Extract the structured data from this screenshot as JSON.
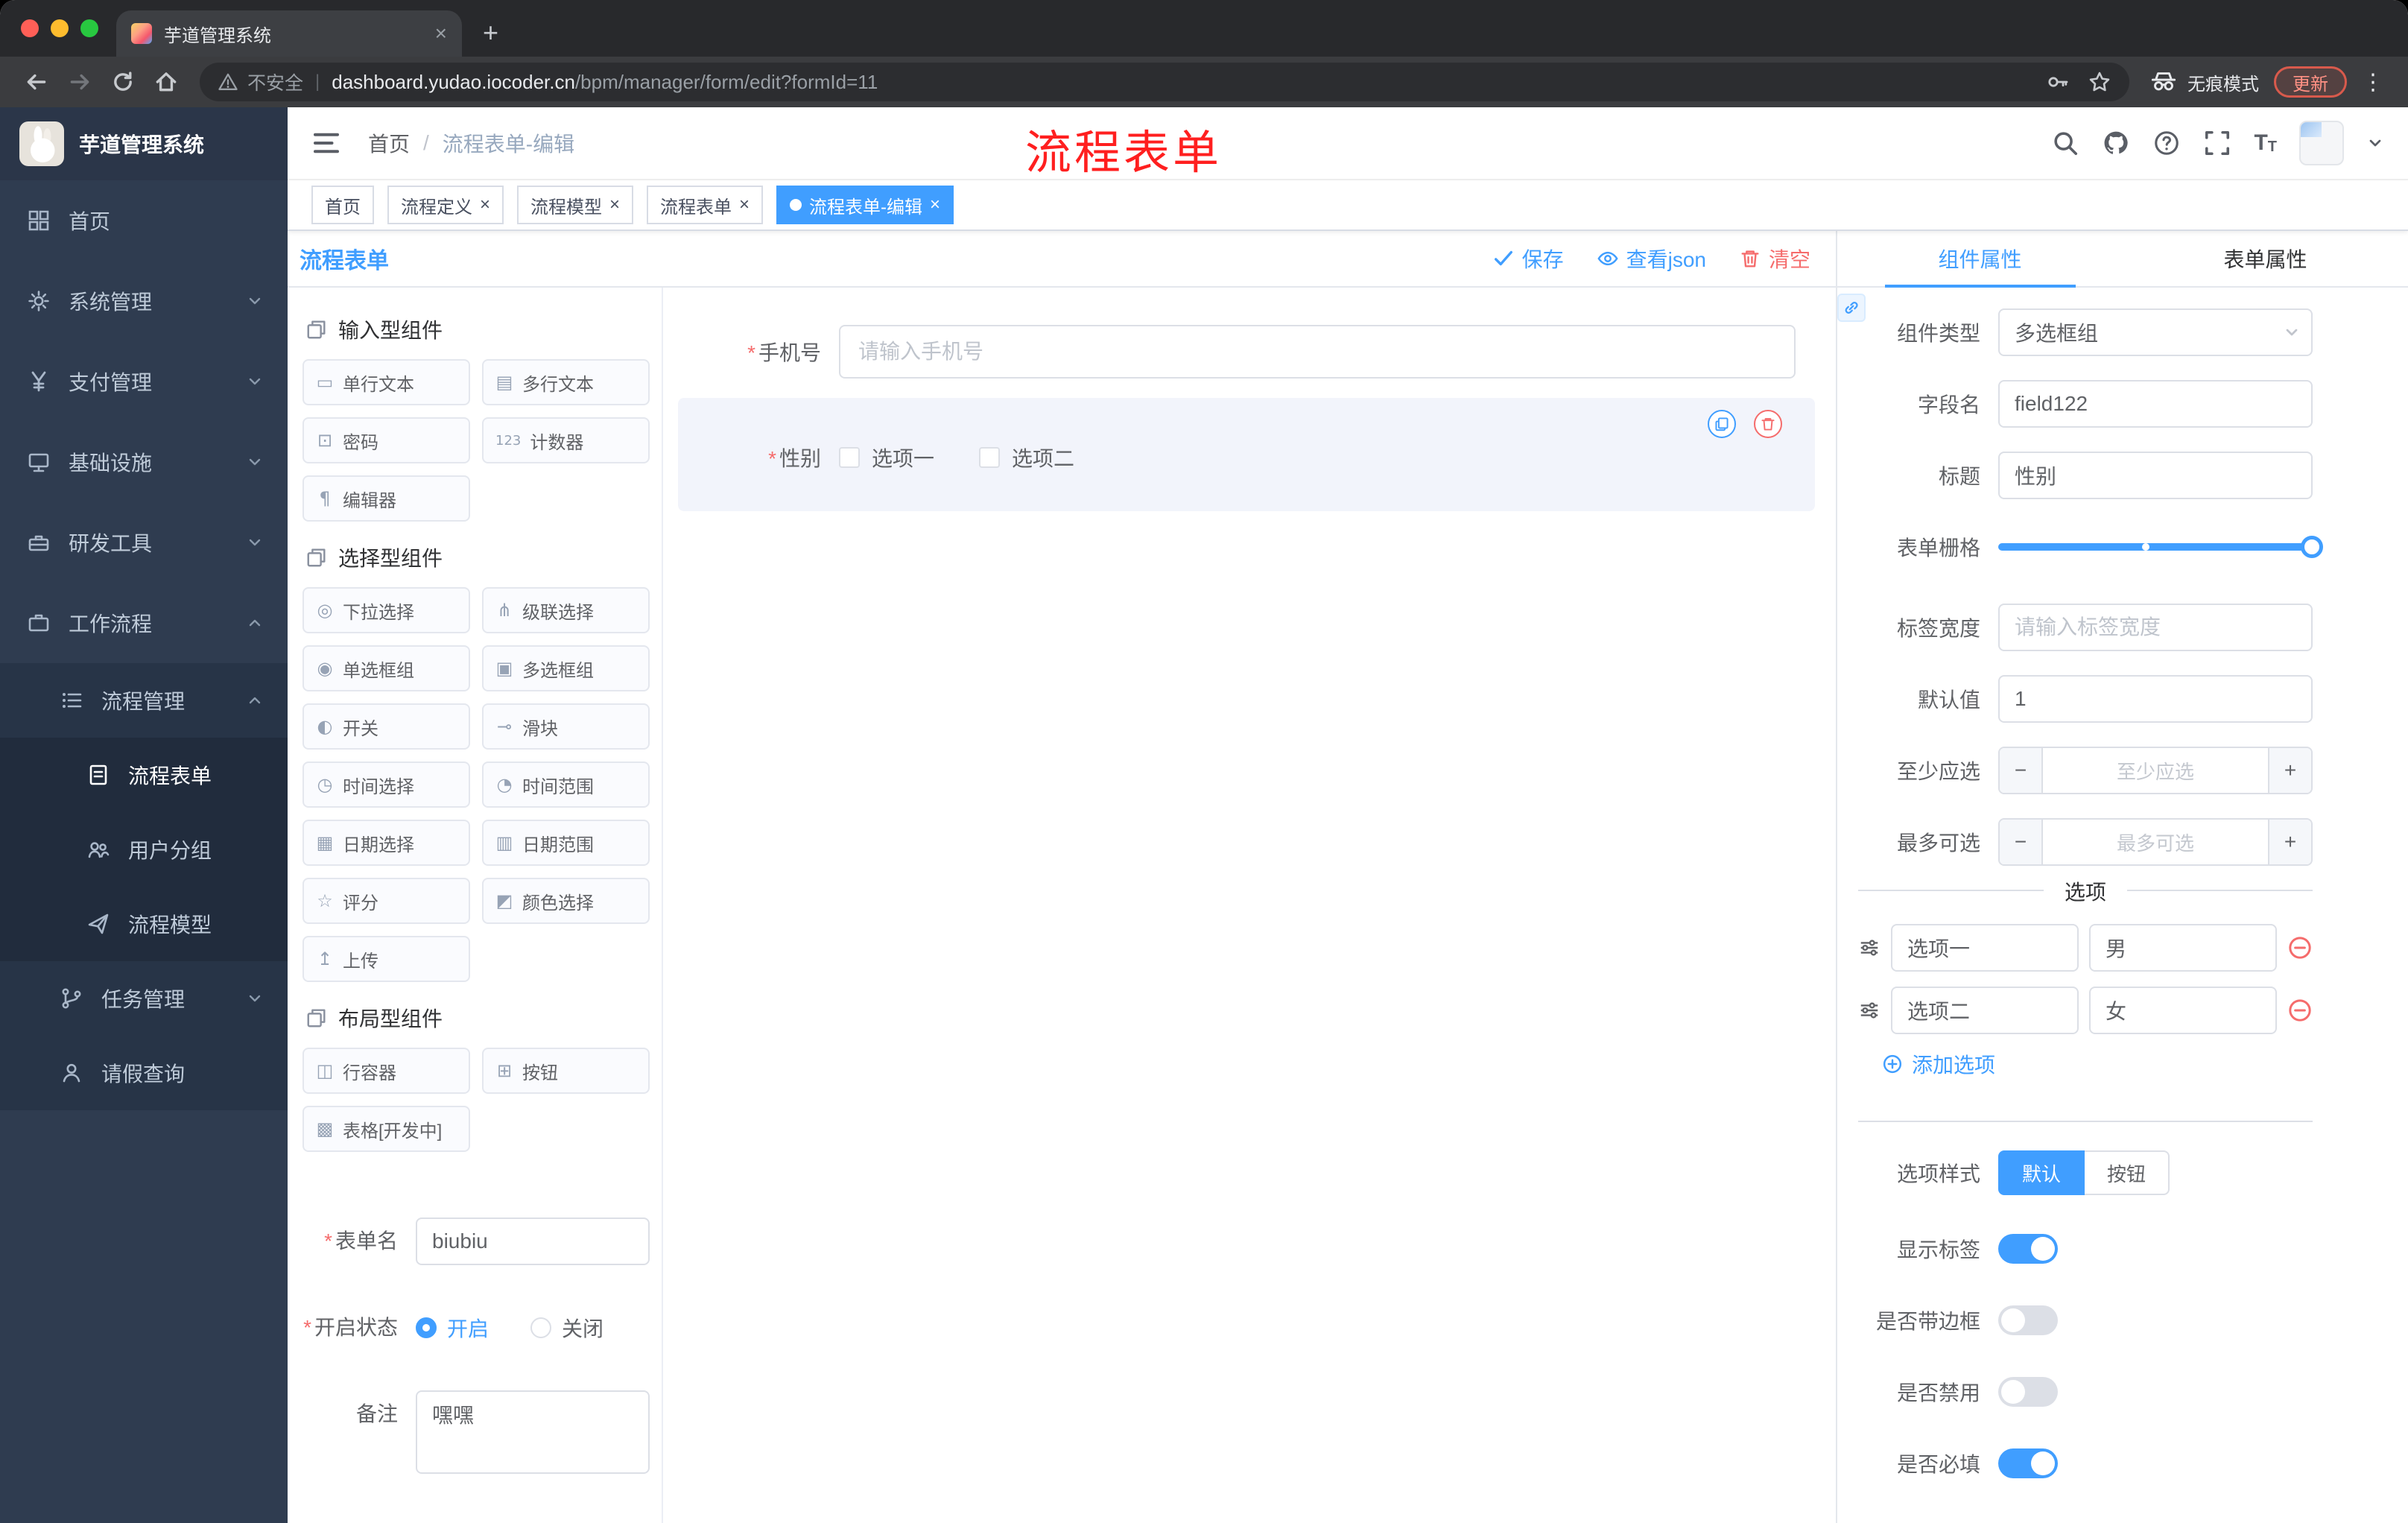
{
  "browser": {
    "tab_title": "芋道管理系统",
    "security_label": "不安全",
    "url_host": "dashboard.yudao.iocoder.cn",
    "url_path": "/bpm/manager/form/edit?formId=11",
    "incognito_label": "无痕模式",
    "update_label": "更新"
  },
  "annotation": {
    "text": "流程表单",
    "color": "#ff1f1f"
  },
  "sidebar": {
    "logo_title": "芋道管理系统",
    "menu": [
      {
        "label": "首页"
      },
      {
        "label": "系统管理"
      },
      {
        "label": "支付管理"
      },
      {
        "label": "基础设施"
      },
      {
        "label": "研发工具"
      },
      {
        "label": "工作流程"
      },
      {
        "label": "流程管理"
      },
      {
        "label": "流程表单"
      },
      {
        "label": "用户分组"
      },
      {
        "label": "流程模型"
      },
      {
        "label": "任务管理"
      },
      {
        "label": "请假查询"
      }
    ]
  },
  "navbar": {
    "breadcrumb": [
      "首页",
      "流程表单-编辑"
    ]
  },
  "tags": [
    {
      "label": "首页"
    },
    {
      "label": "流程定义"
    },
    {
      "label": "流程模型"
    },
    {
      "label": "流程表单"
    },
    {
      "label": "流程表单-编辑"
    }
  ],
  "designer": {
    "title": "流程表单",
    "save": "保存",
    "view_json": "查看json",
    "clear": "清空"
  },
  "components": {
    "groups": [
      {
        "title": "输入型组件",
        "items": [
          {
            "label": "单行文本",
            "icon": "▭"
          },
          {
            "label": "多行文本",
            "icon": "▤"
          },
          {
            "label": "密码",
            "icon": "⊡"
          },
          {
            "label": "计数器",
            "icon": "123"
          },
          {
            "label": "编辑器",
            "icon": "¶"
          }
        ]
      },
      {
        "title": "选择型组件",
        "items": [
          {
            "label": "下拉选择",
            "icon": "◎"
          },
          {
            "label": "级联选择",
            "icon": "⋔"
          },
          {
            "label": "单选框组",
            "icon": "◉"
          },
          {
            "label": "多选框组",
            "icon": "▣"
          },
          {
            "label": "开关",
            "icon": "◐"
          },
          {
            "label": "滑块",
            "icon": "⊸"
          },
          {
            "label": "时间选择",
            "icon": "◷"
          },
          {
            "label": "时间范围",
            "icon": "◔"
          },
          {
            "label": "日期选择",
            "icon": "▦"
          },
          {
            "label": "日期范围",
            "icon": "▥"
          },
          {
            "label": "评分",
            "icon": "☆"
          },
          {
            "label": "颜色选择",
            "icon": "◩"
          },
          {
            "label": "上传",
            "icon": "↥"
          }
        ]
      },
      {
        "title": "布局型组件",
        "items": [
          {
            "label": "行容器",
            "icon": "◫"
          },
          {
            "label": "按钮",
            "icon": "⊞"
          },
          {
            "label": "表格[开发中]",
            "icon": "▩"
          }
        ]
      }
    ]
  },
  "form_meta": {
    "name_label": "表单名",
    "name_value": "biubiu",
    "status_label": "开启状态",
    "status_on": "开启",
    "status_off": "关闭",
    "remark_label": "备注",
    "remark_value": "嘿嘿"
  },
  "canvas": {
    "phone": {
      "label": "手机号",
      "placeholder": "请输入手机号"
    },
    "gender": {
      "label": "性别",
      "options": [
        "选项一",
        "选项二"
      ]
    }
  },
  "props": {
    "tabs": [
      "组件属性",
      "表单属性"
    ],
    "fields": {
      "type_label": "组件类型",
      "type_value": "多选框组",
      "field_label": "字段名",
      "field_value": "field122",
      "title_label": "标题",
      "title_value": "性别",
      "grid_label": "表单栅格",
      "label_width_label": "标签宽度",
      "label_width_placeholder": "请输入标签宽度",
      "default_label": "默认值",
      "default_value": "1",
      "min_label": "至少应选",
      "min_placeholder": "至少应选",
      "max_label": "最多可选",
      "max_placeholder": "最多可选"
    },
    "options_title": "选项",
    "options": [
      {
        "label": "选项一",
        "value": "男"
      },
      {
        "label": "选项二",
        "value": "女"
      }
    ],
    "add_option": "添加选项",
    "style_label": "选项样式",
    "style_default": "默认",
    "style_button": "按钮",
    "toggles": [
      {
        "label": "显示标签",
        "on": true
      },
      {
        "label": "是否带边框",
        "on": false
      },
      {
        "label": "是否禁用",
        "on": false
      },
      {
        "label": "是否必填",
        "on": true
      }
    ]
  },
  "colors": {
    "accent": "#409eff",
    "danger": "#f56c6c",
    "sidebar_bg": "#2f3c50"
  }
}
